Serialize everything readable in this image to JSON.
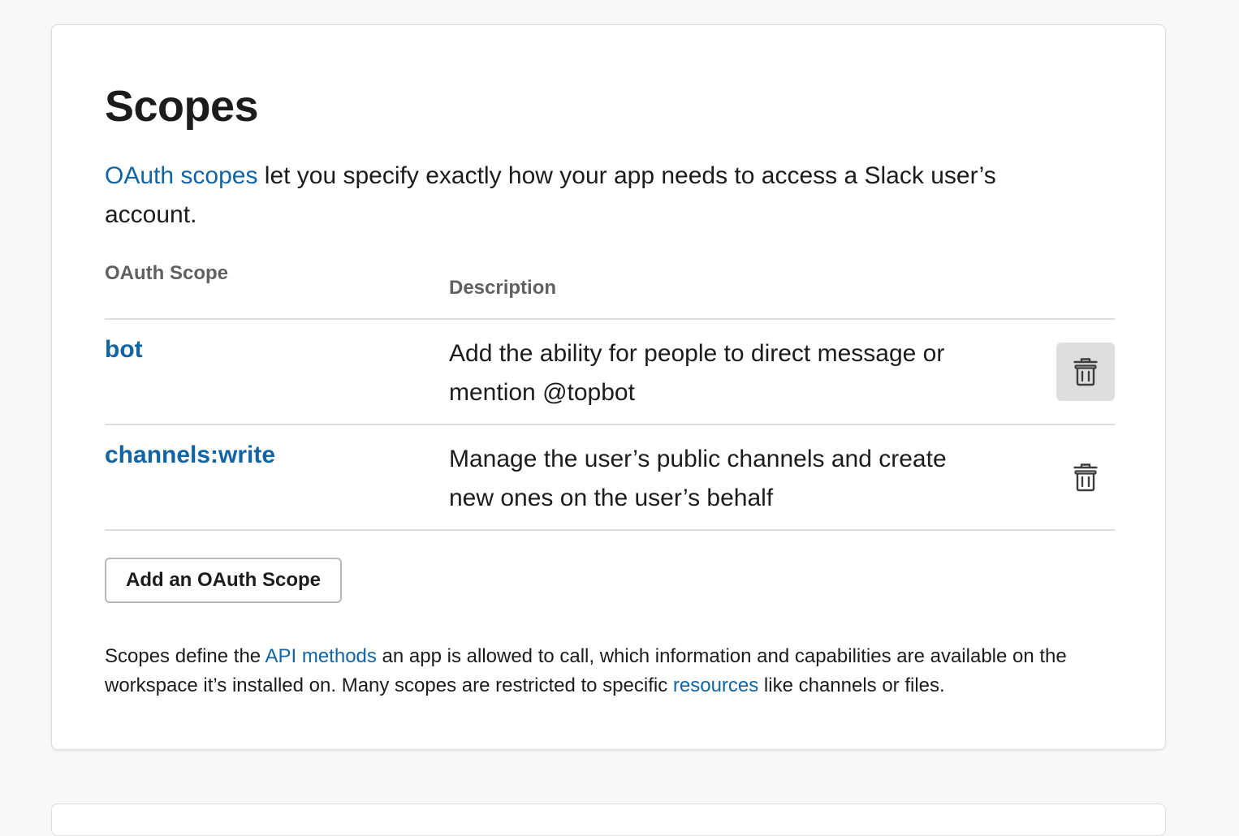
{
  "section": {
    "title": "Scopes",
    "intro": {
      "link_text": "OAuth scopes",
      "text_after": " let you specify exactly how your app needs to access a Slack user’s account."
    },
    "columns": {
      "scope": "OAuth Scope",
      "description": "Description"
    },
    "scopes": [
      {
        "name": "bot",
        "description": "Add the ability for people to direct message or mention @topbot"
      },
      {
        "name": "channels:write",
        "description": "Manage the user’s public channels and create new ones on the user’s behalf"
      }
    ],
    "add_button_label": "Add an OAuth Scope",
    "footer": {
      "text_before": "Scopes define the ",
      "api_link": "API methods",
      "text_middle": " an app is allowed to call, which information and capabilities are available on the workspace it’s installed on. Many scopes are restricted to specific ",
      "resources_link": "resources",
      "text_after": " like channels or files."
    }
  },
  "icons": {
    "delete": "trash-icon"
  },
  "colors": {
    "link": "#1264a3",
    "text": "#1d1c1d",
    "muted": "#616061",
    "background": "#f8f8f8"
  }
}
